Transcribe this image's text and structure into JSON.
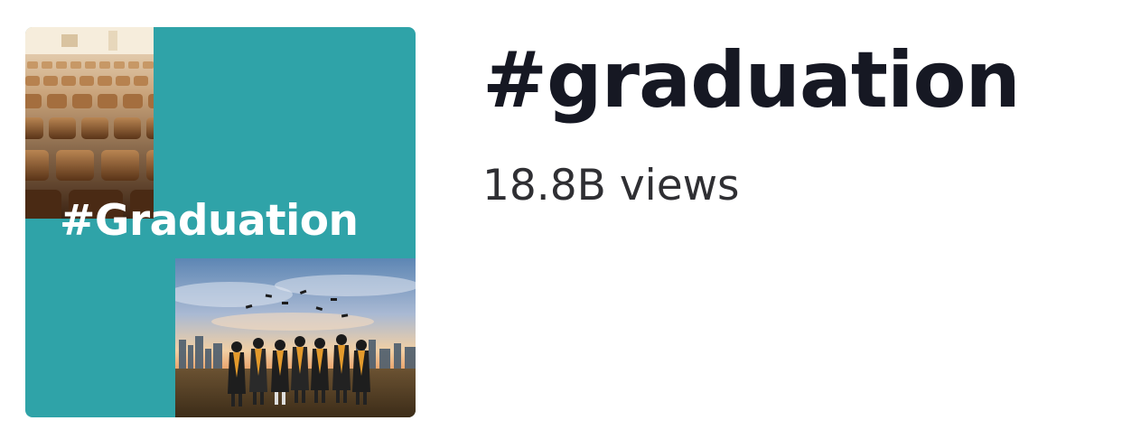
{
  "hashtag": {
    "cover": {
      "text": "#Graduation",
      "background_color": "#2fa3a8",
      "text_color": "#ffffff",
      "images": [
        "auditorium-seats-photo",
        "graduates-throwing-caps-photo"
      ]
    },
    "title": "#graduation",
    "views": "18.8B views"
  }
}
